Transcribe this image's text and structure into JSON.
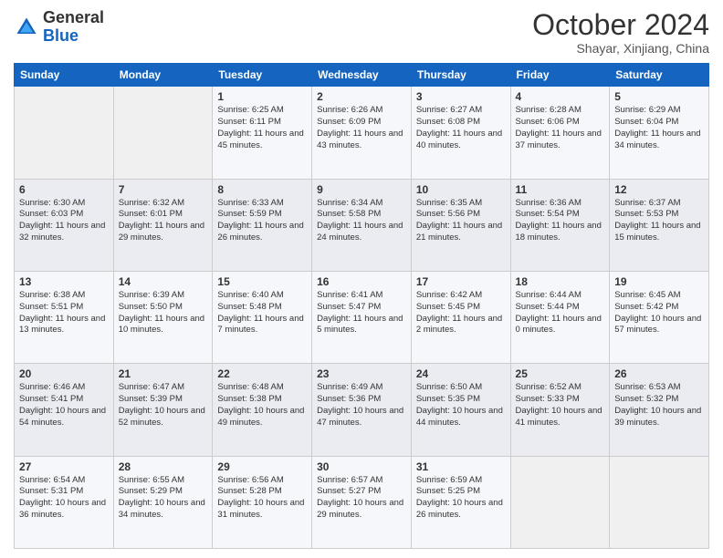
{
  "header": {
    "logo_general": "General",
    "logo_blue": "Blue",
    "month": "October 2024",
    "location": "Shayar, Xinjiang, China"
  },
  "days_of_week": [
    "Sunday",
    "Monday",
    "Tuesday",
    "Wednesday",
    "Thursday",
    "Friday",
    "Saturday"
  ],
  "weeks": [
    [
      {
        "day": "",
        "info": ""
      },
      {
        "day": "",
        "info": ""
      },
      {
        "day": "1",
        "info": "Sunrise: 6:25 AM\nSunset: 6:11 PM\nDaylight: 11 hours and 45 minutes."
      },
      {
        "day": "2",
        "info": "Sunrise: 6:26 AM\nSunset: 6:09 PM\nDaylight: 11 hours and 43 minutes."
      },
      {
        "day": "3",
        "info": "Sunrise: 6:27 AM\nSunset: 6:08 PM\nDaylight: 11 hours and 40 minutes."
      },
      {
        "day": "4",
        "info": "Sunrise: 6:28 AM\nSunset: 6:06 PM\nDaylight: 11 hours and 37 minutes."
      },
      {
        "day": "5",
        "info": "Sunrise: 6:29 AM\nSunset: 6:04 PM\nDaylight: 11 hours and 34 minutes."
      }
    ],
    [
      {
        "day": "6",
        "info": "Sunrise: 6:30 AM\nSunset: 6:03 PM\nDaylight: 11 hours and 32 minutes."
      },
      {
        "day": "7",
        "info": "Sunrise: 6:32 AM\nSunset: 6:01 PM\nDaylight: 11 hours and 29 minutes."
      },
      {
        "day": "8",
        "info": "Sunrise: 6:33 AM\nSunset: 5:59 PM\nDaylight: 11 hours and 26 minutes."
      },
      {
        "day": "9",
        "info": "Sunrise: 6:34 AM\nSunset: 5:58 PM\nDaylight: 11 hours and 24 minutes."
      },
      {
        "day": "10",
        "info": "Sunrise: 6:35 AM\nSunset: 5:56 PM\nDaylight: 11 hours and 21 minutes."
      },
      {
        "day": "11",
        "info": "Sunrise: 6:36 AM\nSunset: 5:54 PM\nDaylight: 11 hours and 18 minutes."
      },
      {
        "day": "12",
        "info": "Sunrise: 6:37 AM\nSunset: 5:53 PM\nDaylight: 11 hours and 15 minutes."
      }
    ],
    [
      {
        "day": "13",
        "info": "Sunrise: 6:38 AM\nSunset: 5:51 PM\nDaylight: 11 hours and 13 minutes."
      },
      {
        "day": "14",
        "info": "Sunrise: 6:39 AM\nSunset: 5:50 PM\nDaylight: 11 hours and 10 minutes."
      },
      {
        "day": "15",
        "info": "Sunrise: 6:40 AM\nSunset: 5:48 PM\nDaylight: 11 hours and 7 minutes."
      },
      {
        "day": "16",
        "info": "Sunrise: 6:41 AM\nSunset: 5:47 PM\nDaylight: 11 hours and 5 minutes."
      },
      {
        "day": "17",
        "info": "Sunrise: 6:42 AM\nSunset: 5:45 PM\nDaylight: 11 hours and 2 minutes."
      },
      {
        "day": "18",
        "info": "Sunrise: 6:44 AM\nSunset: 5:44 PM\nDaylight: 11 hours and 0 minutes."
      },
      {
        "day": "19",
        "info": "Sunrise: 6:45 AM\nSunset: 5:42 PM\nDaylight: 10 hours and 57 minutes."
      }
    ],
    [
      {
        "day": "20",
        "info": "Sunrise: 6:46 AM\nSunset: 5:41 PM\nDaylight: 10 hours and 54 minutes."
      },
      {
        "day": "21",
        "info": "Sunrise: 6:47 AM\nSunset: 5:39 PM\nDaylight: 10 hours and 52 minutes."
      },
      {
        "day": "22",
        "info": "Sunrise: 6:48 AM\nSunset: 5:38 PM\nDaylight: 10 hours and 49 minutes."
      },
      {
        "day": "23",
        "info": "Sunrise: 6:49 AM\nSunset: 5:36 PM\nDaylight: 10 hours and 47 minutes."
      },
      {
        "day": "24",
        "info": "Sunrise: 6:50 AM\nSunset: 5:35 PM\nDaylight: 10 hours and 44 minutes."
      },
      {
        "day": "25",
        "info": "Sunrise: 6:52 AM\nSunset: 5:33 PM\nDaylight: 10 hours and 41 minutes."
      },
      {
        "day": "26",
        "info": "Sunrise: 6:53 AM\nSunset: 5:32 PM\nDaylight: 10 hours and 39 minutes."
      }
    ],
    [
      {
        "day": "27",
        "info": "Sunrise: 6:54 AM\nSunset: 5:31 PM\nDaylight: 10 hours and 36 minutes."
      },
      {
        "day": "28",
        "info": "Sunrise: 6:55 AM\nSunset: 5:29 PM\nDaylight: 10 hours and 34 minutes."
      },
      {
        "day": "29",
        "info": "Sunrise: 6:56 AM\nSunset: 5:28 PM\nDaylight: 10 hours and 31 minutes."
      },
      {
        "day": "30",
        "info": "Sunrise: 6:57 AM\nSunset: 5:27 PM\nDaylight: 10 hours and 29 minutes."
      },
      {
        "day": "31",
        "info": "Sunrise: 6:59 AM\nSunset: 5:25 PM\nDaylight: 10 hours and 26 minutes."
      },
      {
        "day": "",
        "info": ""
      },
      {
        "day": "",
        "info": ""
      }
    ]
  ]
}
